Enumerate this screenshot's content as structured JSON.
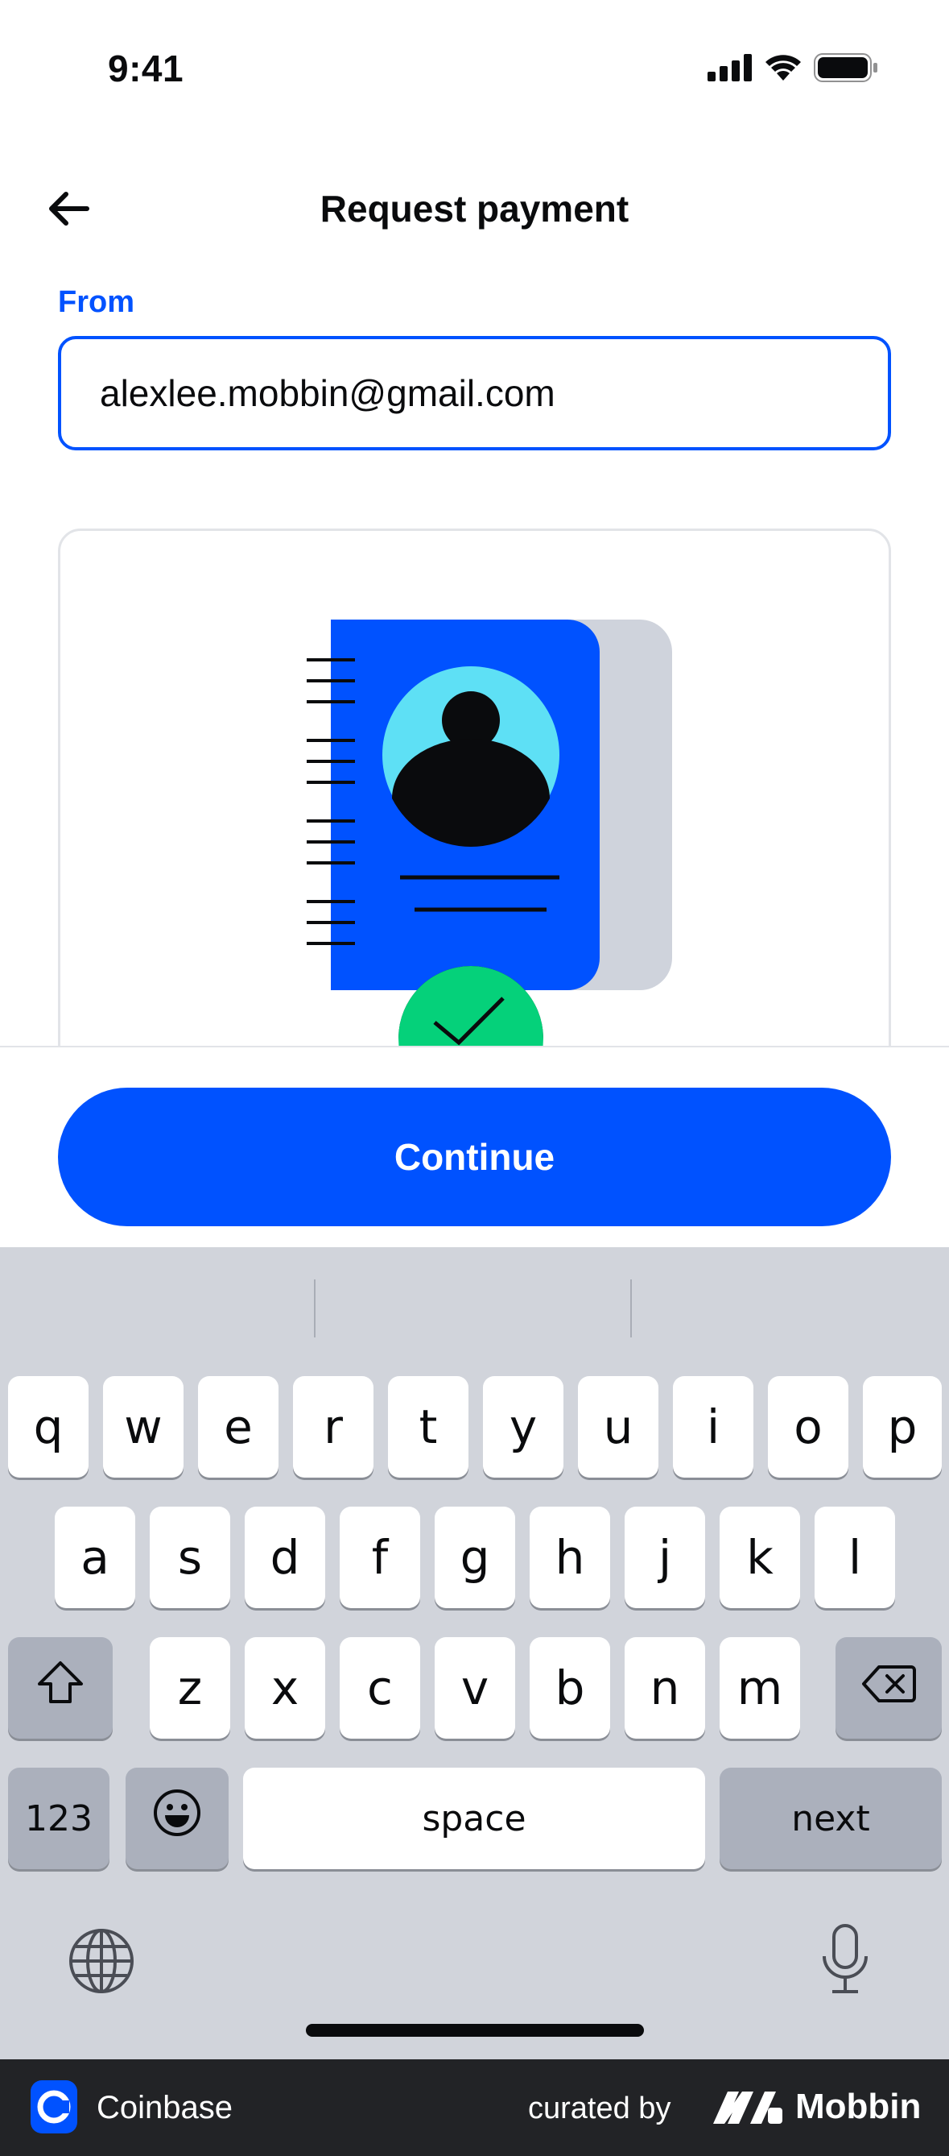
{
  "status_bar": {
    "time": "9:41"
  },
  "header": {
    "title": "Request payment"
  },
  "form": {
    "from_label": "From",
    "email_value": "alexlee.mobbin@gmail.com"
  },
  "actions": {
    "continue_label": "Continue"
  },
  "keyboard": {
    "row1": [
      "q",
      "w",
      "e",
      "r",
      "t",
      "y",
      "u",
      "i",
      "o",
      "p"
    ],
    "row2": [
      "a",
      "s",
      "d",
      "f",
      "g",
      "h",
      "j",
      "k",
      "l"
    ],
    "row3": [
      "z",
      "x",
      "c",
      "v",
      "b",
      "n",
      "m"
    ],
    "numbers_label": "123",
    "space_label": "space",
    "next_label": "next"
  },
  "footer": {
    "brand": "Coinbase",
    "curated_by": "curated by",
    "curator": "Mobbin"
  },
  "colors": {
    "accent": "#0052ff",
    "keyboard_bg": "#d1d4db",
    "illustration_cyan": "#5ee0f5",
    "illustration_green": "#05d17a",
    "footer_bg": "#222326"
  },
  "icons": {
    "back": "arrow-left-icon",
    "signal": "cellular-signal-icon",
    "wifi": "wifi-icon",
    "battery": "battery-icon",
    "shift": "shift-icon",
    "delete": "delete-icon",
    "emoji": "emoji-icon",
    "globe": "globe-icon",
    "mic": "microphone-icon"
  }
}
